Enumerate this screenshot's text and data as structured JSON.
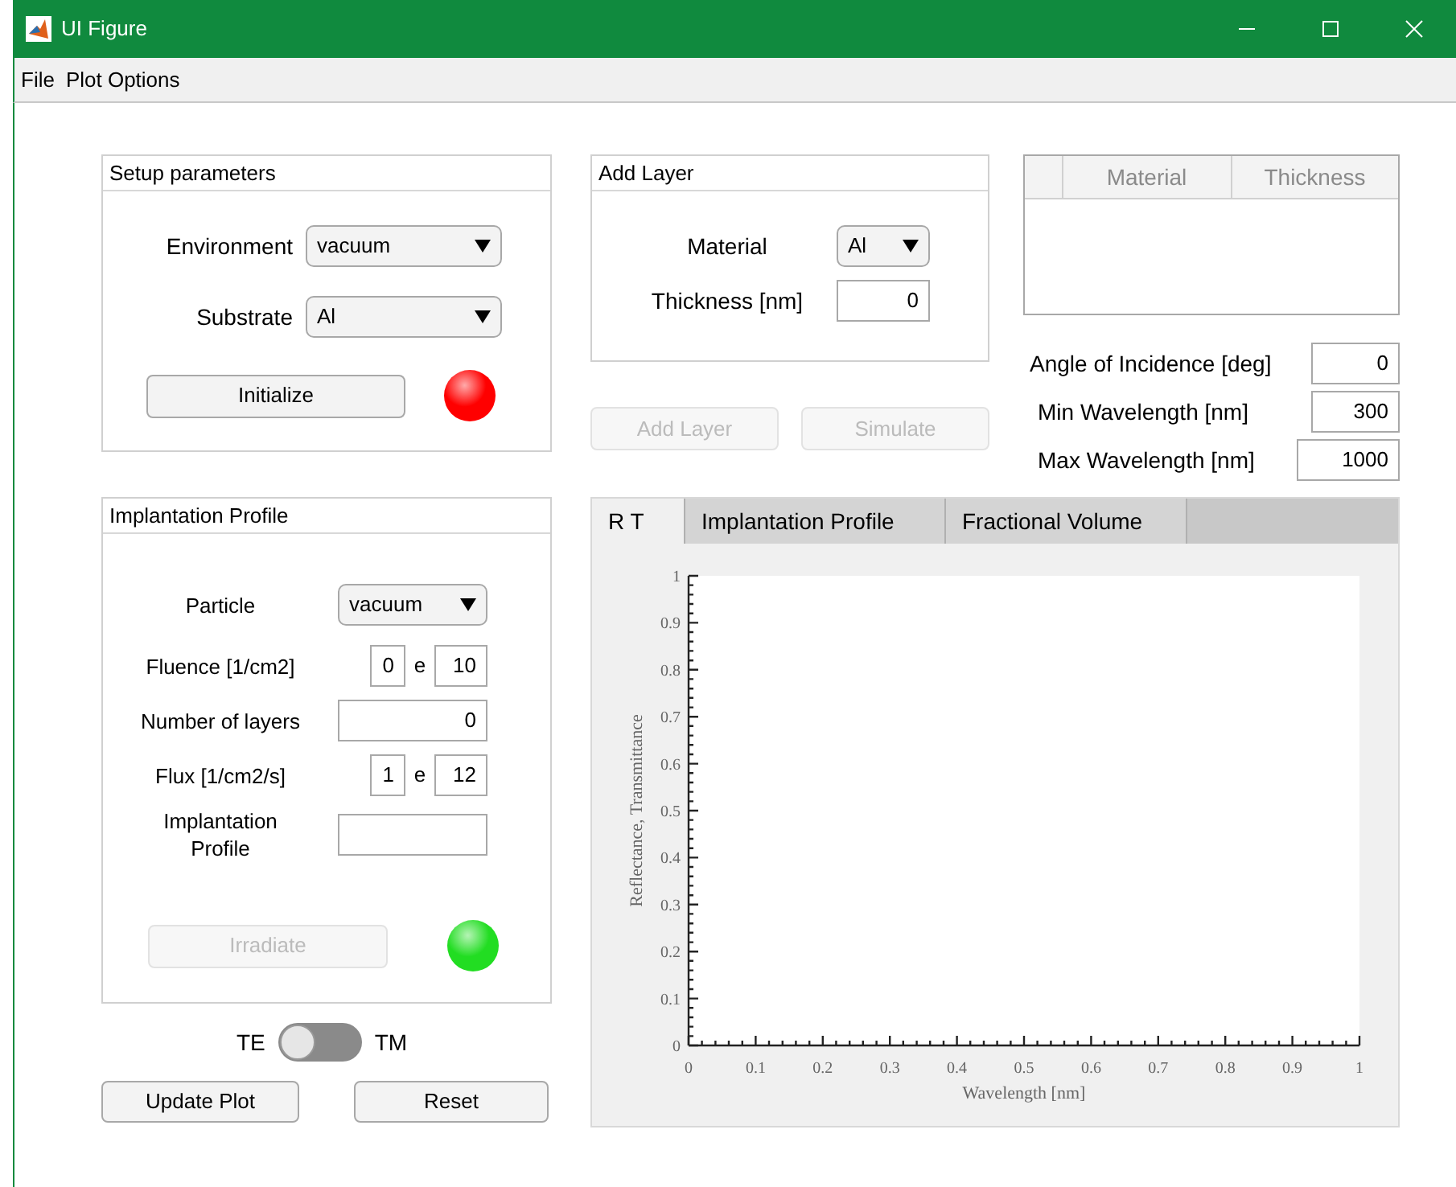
{
  "window": {
    "title": "UI Figure"
  },
  "menu": [
    "File",
    "Plot Options"
  ],
  "setup": {
    "title": "Setup parameters",
    "dropdowns": [
      {
        "label": "Environment",
        "value": "vacuum"
      },
      {
        "label": "Substrate",
        "value": "Al"
      }
    ],
    "button": {
      "label": "Initialize",
      "disabled": false
    },
    "lamp": {
      "color": "#ff0000"
    }
  },
  "implantation": {
    "title": "Implantation Profile",
    "rows": [
      {
        "kind": "dropdown",
        "label": "Particle",
        "value": "vacuum"
      },
      {
        "kind": "exponent",
        "label": "Fluence [1/cm2]",
        "mantissa": "0",
        "separator": "e",
        "exponent": "10"
      },
      {
        "kind": "field",
        "label": "Number of layers",
        "value": "0"
      },
      {
        "kind": "exponent",
        "label": "Flux [1/cm2/s]",
        "mantissa": "1",
        "separator": "e",
        "exponent": "12"
      },
      {
        "kind": "field",
        "label": "Implantation Profile"
      }
    ],
    "button": {
      "label": "Irradiate",
      "disabled": true
    },
    "lamp": {
      "color": "#22dd22"
    }
  },
  "polarization": {
    "left": "TE",
    "right": "TM",
    "on": false
  },
  "buttons": [
    {
      "label": "Update Plot",
      "disabled": false
    },
    {
      "label": "Reset",
      "disabled": false
    }
  ],
  "add_layer": {
    "title": "Add Layer",
    "material": {
      "label": "Material",
      "value": "Al"
    },
    "thickness": {
      "label": "Thickness [nm]",
      "value": "0"
    }
  },
  "actions": [
    {
      "label": "Add Layer",
      "disabled": true
    },
    {
      "label": "Simulate",
      "disabled": true
    }
  ],
  "layer_table": {
    "columns": [
      "Material",
      "Thickness"
    ]
  },
  "settings": [
    {
      "label": "Angle of Incidence [deg]",
      "value": "0"
    },
    {
      "label": "Min Wavelength [nm]",
      "value": "300"
    },
    {
      "label": "Max Wavelength [nm]",
      "value": "1000"
    }
  ],
  "plot_tabs": [
    {
      "label": "R T",
      "selected": true
    },
    {
      "label": "Implantation Profile",
      "selected": false
    },
    {
      "label": "Fractional Volume",
      "selected": false
    }
  ],
  "chart_data": {
    "type": "line",
    "xlabel": "Wavelength [nm]",
    "ylabel": "Reflectance, Transmittance",
    "xlim": [
      0,
      1
    ],
    "ylim": [
      0,
      1
    ],
    "xticks": [
      0,
      0.1,
      0.2,
      0.3,
      0.4,
      0.5,
      0.6,
      0.7,
      0.8,
      0.9,
      1
    ],
    "yticks": [
      0,
      0.1,
      0.2,
      0.3,
      0.4,
      0.5,
      0.6,
      0.7,
      0.8,
      0.9,
      1
    ]
  }
}
